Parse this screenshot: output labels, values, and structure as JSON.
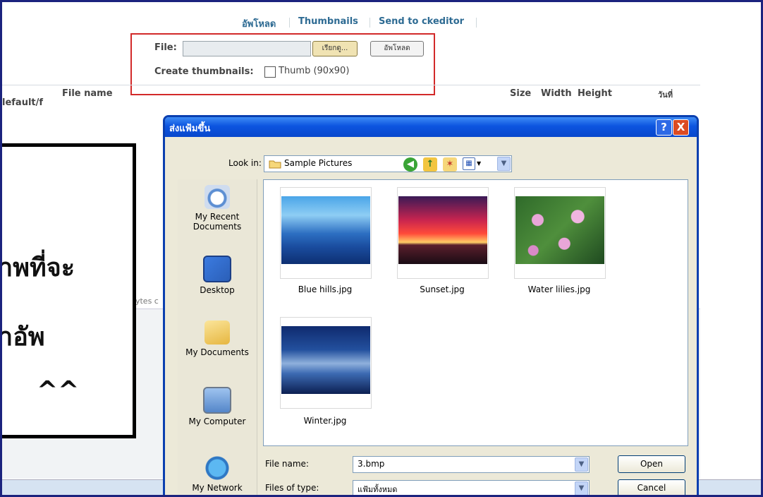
{
  "page": {
    "nav": [
      "อัพโหลด",
      "Thumbnails",
      "Send to ckeditor"
    ],
    "upload": {
      "file_label": "File:",
      "browse_label": "เรียกดู...",
      "upload_label": "อัพโหลด",
      "create_thumbnails_label": "Create thumbnails:",
      "thumb_option": "Thumb (90x90)"
    },
    "table": {
      "path_fragment": "lefault/f",
      "col_filename": "File name",
      "col_size": "Size",
      "col_width": "Width",
      "col_height": "Height",
      "col_date": "วันที่",
      "bytes_fragment": "bytes c"
    }
  },
  "note": {
    "lines": [
      "าพที่จะ",
      "าอัพ",
      "^^"
    ]
  },
  "dialog": {
    "title": "ส่งแฟ้มขึ้น",
    "help_label": "?",
    "close_label": "X",
    "look_in_label": "Look in:",
    "look_in_value": "Sample Pictures",
    "places": [
      "My Recent Documents",
      "Desktop",
      "My Documents",
      "My Computer",
      "My Network"
    ],
    "files": [
      "Blue hills.jpg",
      "Sunset.jpg",
      "Water lilies.jpg",
      "Winter.jpg"
    ],
    "file_name_label": "File name:",
    "file_name_value": "3.bmp",
    "file_type_label": "Files of type:",
    "file_type_value": "แฟ้มทั้งหมด",
    "open_label": "Open",
    "cancel_label": "Cancel"
  },
  "colors": {
    "frame_border": "#1b237e",
    "link_blue": "#2e6b93",
    "highlight_red": "#d22a2a",
    "xp_titlebar": "#0c54e0"
  }
}
